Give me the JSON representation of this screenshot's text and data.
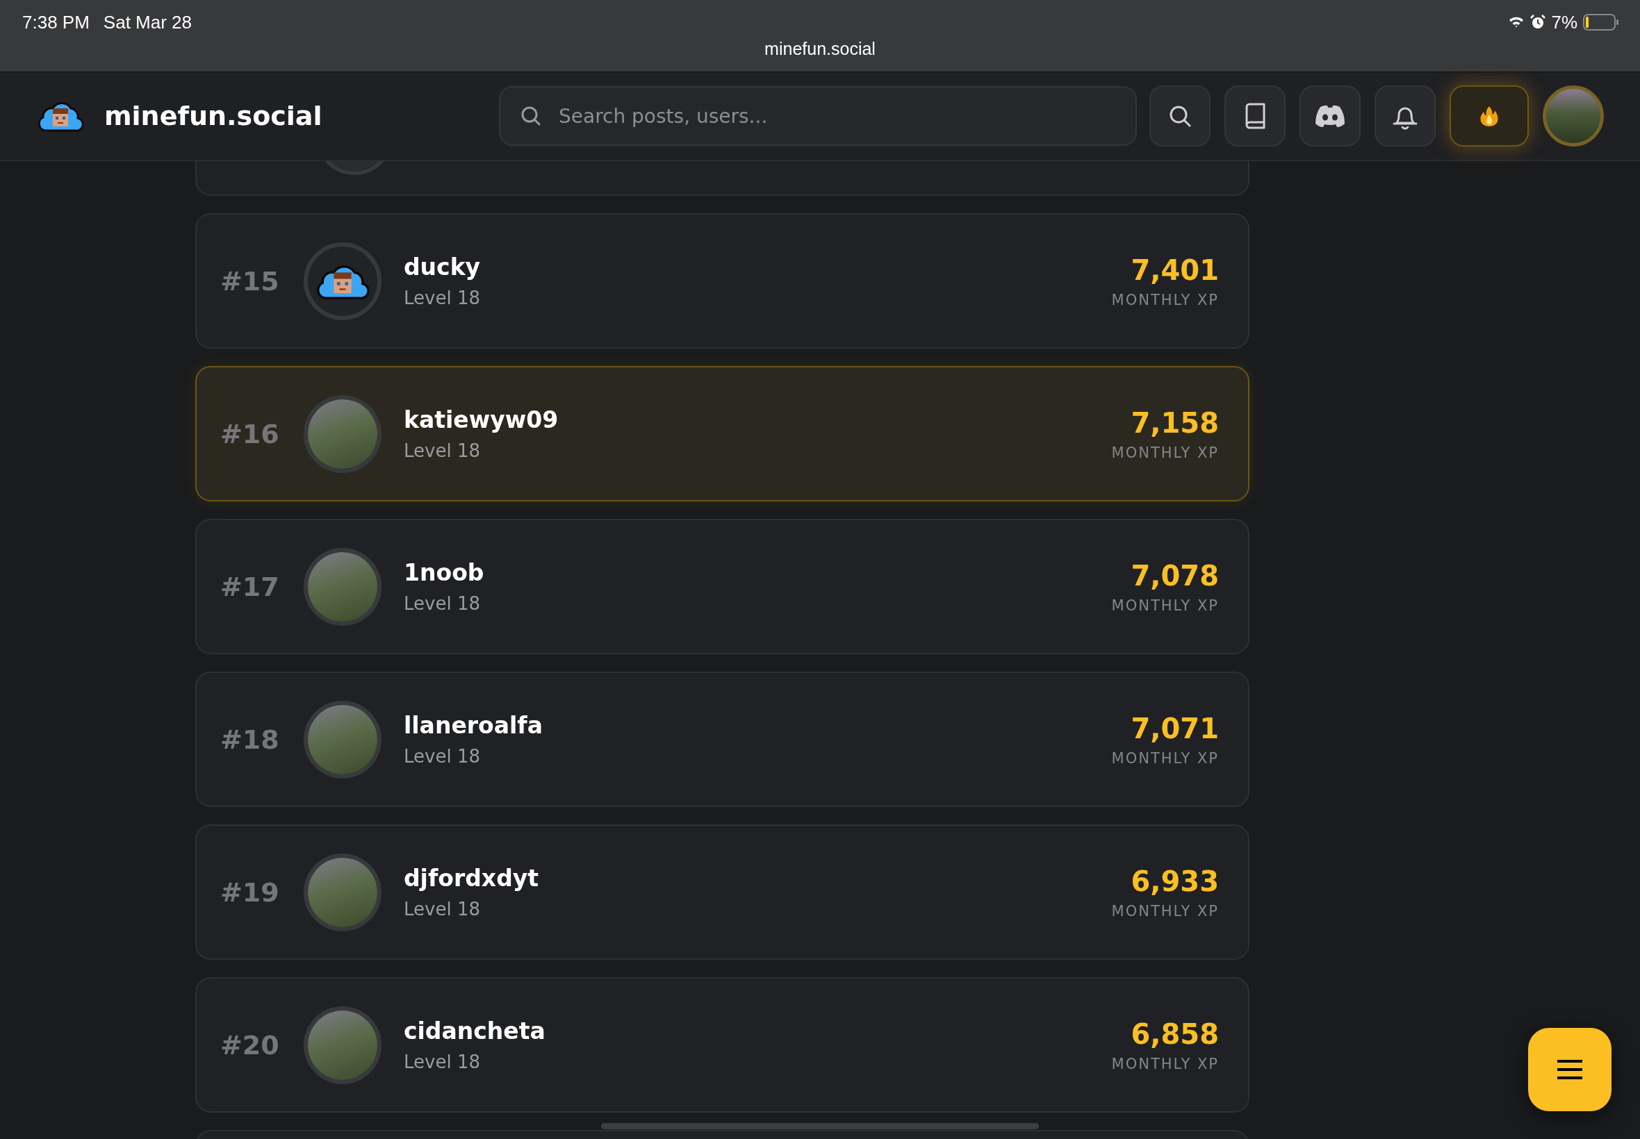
{
  "status_bar": {
    "time": "7:38 PM",
    "date": "Sat Mar 28",
    "battery": "7%"
  },
  "address_bar": {
    "url": "minefun.social"
  },
  "header": {
    "brand": "minefun.social",
    "search": {
      "placeholder": "Search posts, users..."
    }
  },
  "leaderboard": {
    "rows": [
      {
        "rank": "#15",
        "name": "ducky",
        "level": "Level 18",
        "xp": "7,401",
        "xp_label": "MONTHLY XP",
        "kind": "logo",
        "highlighted": false
      },
      {
        "rank": "#16",
        "name": "katiewyw09",
        "level": "Level 18",
        "xp": "7,158",
        "xp_label": "MONTHLY XP",
        "kind": "photo",
        "highlighted": true
      },
      {
        "rank": "#17",
        "name": "1noob",
        "level": "Level 18",
        "xp": "7,078",
        "xp_label": "MONTHLY XP",
        "kind": "photo",
        "highlighted": false
      },
      {
        "rank": "#18",
        "name": "llaneroalfa",
        "level": "Level 18",
        "xp": "7,071",
        "xp_label": "MONTHLY XP",
        "kind": "photo",
        "highlighted": false
      },
      {
        "rank": "#19",
        "name": "djfordxdyt",
        "level": "Level 18",
        "xp": "6,933",
        "xp_label": "MONTHLY XP",
        "kind": "photo",
        "highlighted": false
      },
      {
        "rank": "#20",
        "name": "cidancheta",
        "level": "Level 18",
        "xp": "6,858",
        "xp_label": "MONTHLY XP",
        "kind": "photo",
        "highlighted": false
      }
    ]
  }
}
